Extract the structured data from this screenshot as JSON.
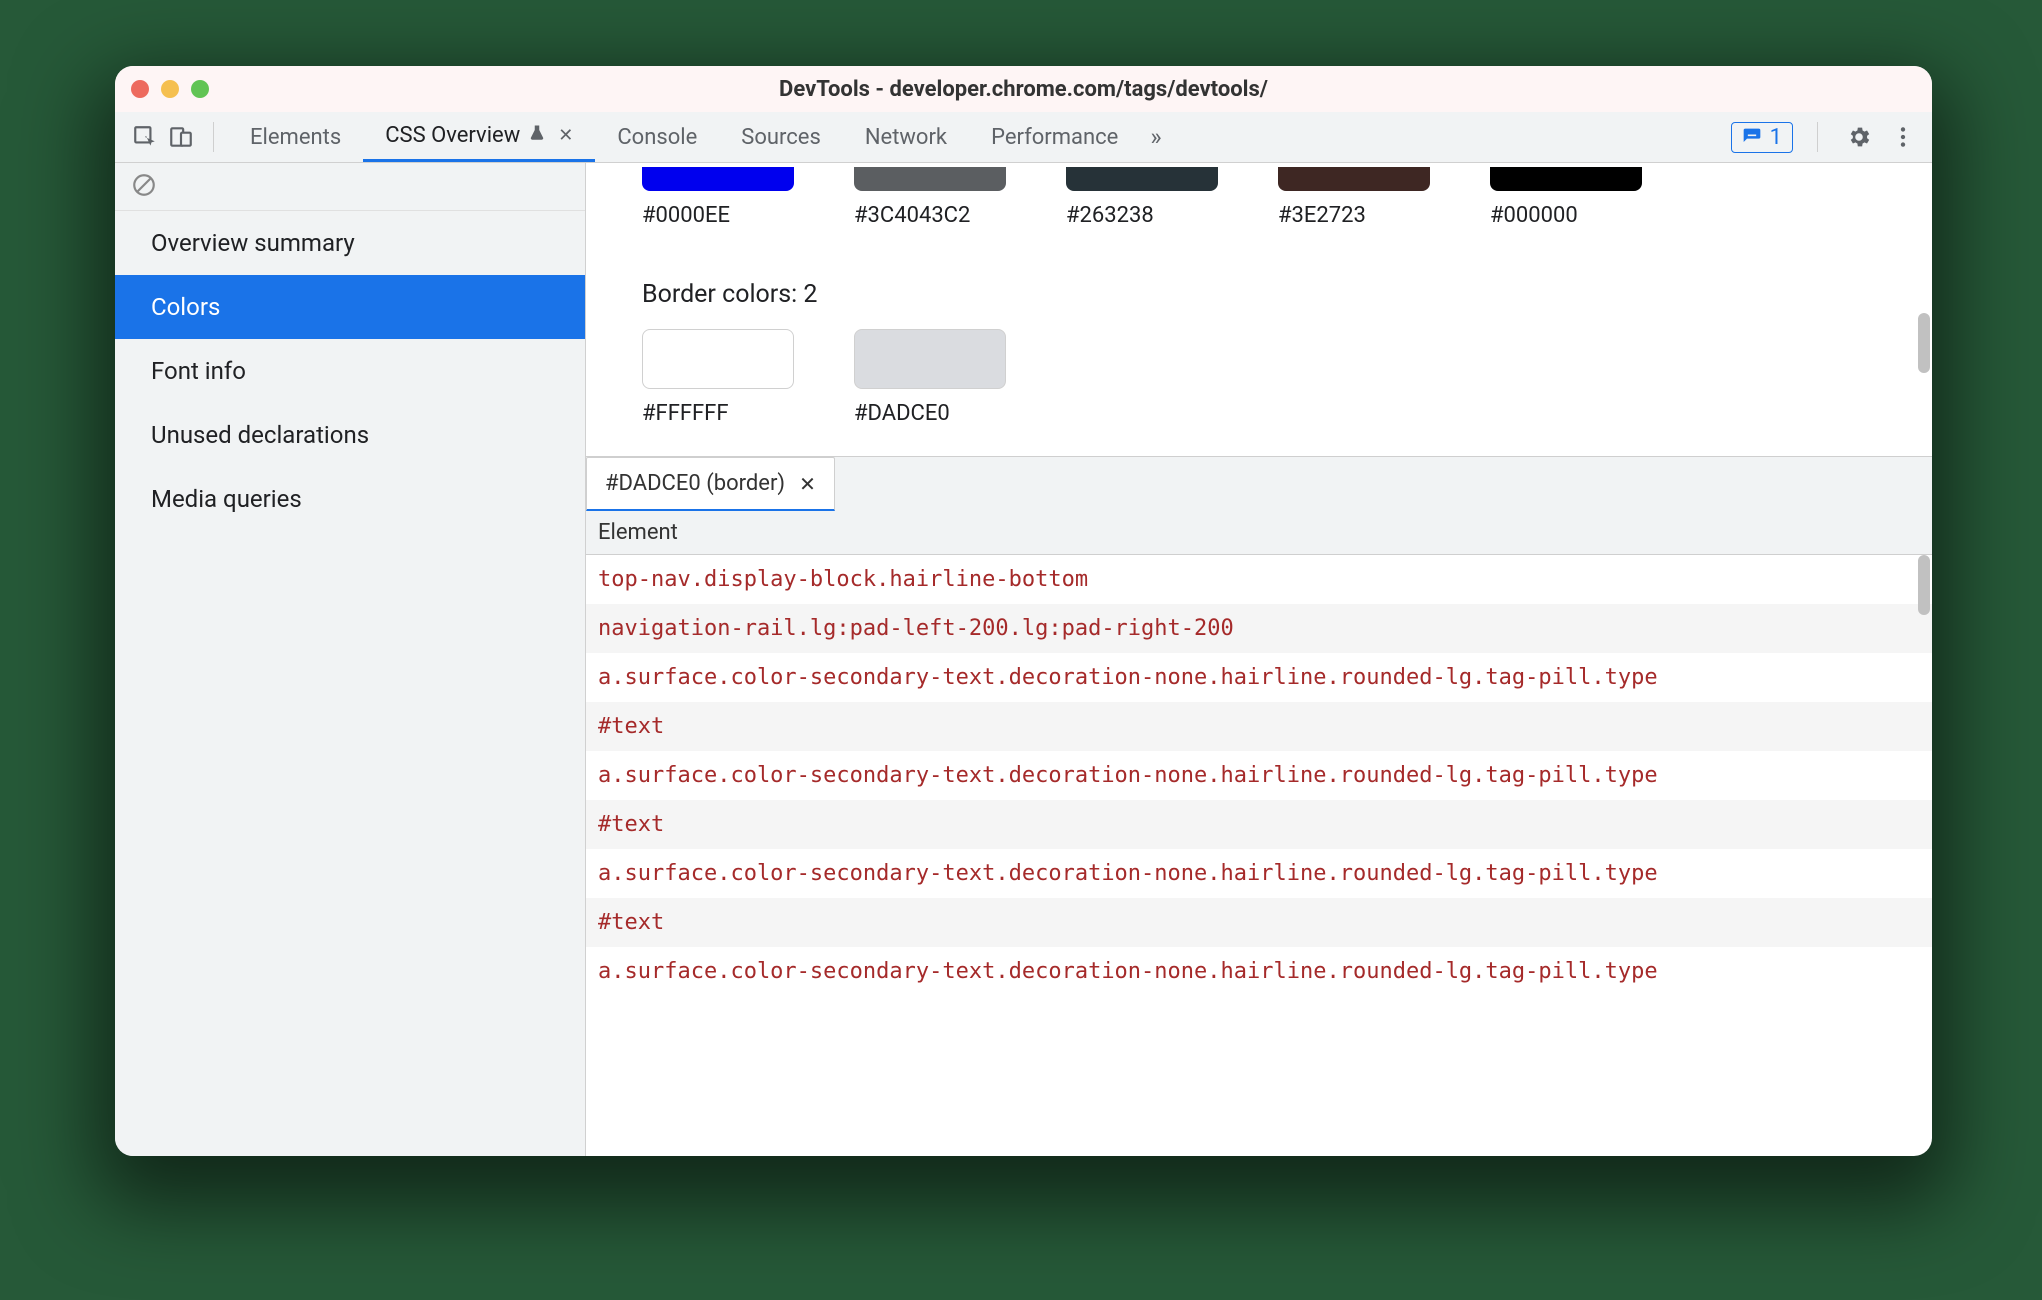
{
  "window": {
    "title": "DevTools - developer.chrome.com/tags/devtools/"
  },
  "tabs": {
    "items": [
      "Elements",
      "CSS Overview",
      "Console",
      "Sources",
      "Network",
      "Performance"
    ],
    "active_index": 1,
    "active_experimental": true
  },
  "issues_count": "1",
  "sidebar": {
    "items": [
      "Overview summary",
      "Colors",
      "Font info",
      "Unused declarations",
      "Media queries"
    ],
    "selected_index": 1
  },
  "top_swatches": [
    {
      "hex": "#0000EE",
      "color": "#0000EE"
    },
    {
      "hex": "#3C4043C2",
      "color": "#5b5e61"
    },
    {
      "hex": "#263238",
      "color": "#263238"
    },
    {
      "hex": "#3E2723",
      "color": "#3E2723"
    },
    {
      "hex": "#000000",
      "color": "#000000"
    }
  ],
  "border_section_title": "Border colors: 2",
  "border_swatches": [
    {
      "hex": "#FFFFFF",
      "color": "#FFFFFF"
    },
    {
      "hex": "#DADCE0",
      "color": "#DADCE0"
    }
  ],
  "details": {
    "tab_label": "#DADCE0 (border)",
    "column_header": "Element",
    "rows": [
      "top-nav.display-block.hairline-bottom",
      "navigation-rail.lg:pad-left-200.lg:pad-right-200",
      "a.surface.color-secondary-text.decoration-none.hairline.rounded-lg.tag-pill.type",
      "#text",
      "a.surface.color-secondary-text.decoration-none.hairline.rounded-lg.tag-pill.type",
      "#text",
      "a.surface.color-secondary-text.decoration-none.hairline.rounded-lg.tag-pill.type",
      "#text",
      "a.surface.color-secondary-text.decoration-none.hairline.rounded-lg.tag-pill.type"
    ]
  }
}
